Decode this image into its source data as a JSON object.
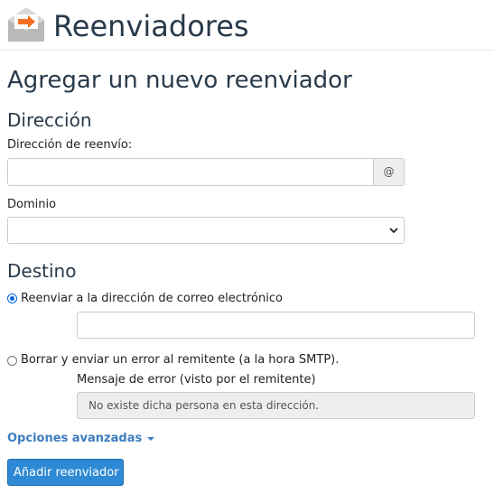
{
  "header": {
    "title": "Reenviadores",
    "icon": "email-forward-icon"
  },
  "page": {
    "heading": "Agregar un nuevo reenviador"
  },
  "address": {
    "group_title": "Dirección",
    "forward_label": "Dirección de reenvío:",
    "forward_value": "",
    "at_addon": "@",
    "domain_label": "Dominio",
    "domain_selected": ""
  },
  "destination": {
    "group_title": "Destino",
    "option_forward": {
      "label": "Reenviar a la dirección de correo electrónico",
      "checked": true,
      "value": ""
    },
    "option_fail": {
      "label": "Borrar y enviar un error al remitente (a la hora SMTP).",
      "checked": false
    },
    "error_label": "Mensaje de error (visto por el remitente)",
    "error_value": "No existe dicha persona en esta dirección."
  },
  "advanced_link": "Opciones avanzadas",
  "submit_label": "Añadir reenviador",
  "colors": {
    "accent": "#2e8ad4",
    "link": "#3b7dbf",
    "icon_orange": "#f26e25",
    "heading": "#293a4a"
  }
}
